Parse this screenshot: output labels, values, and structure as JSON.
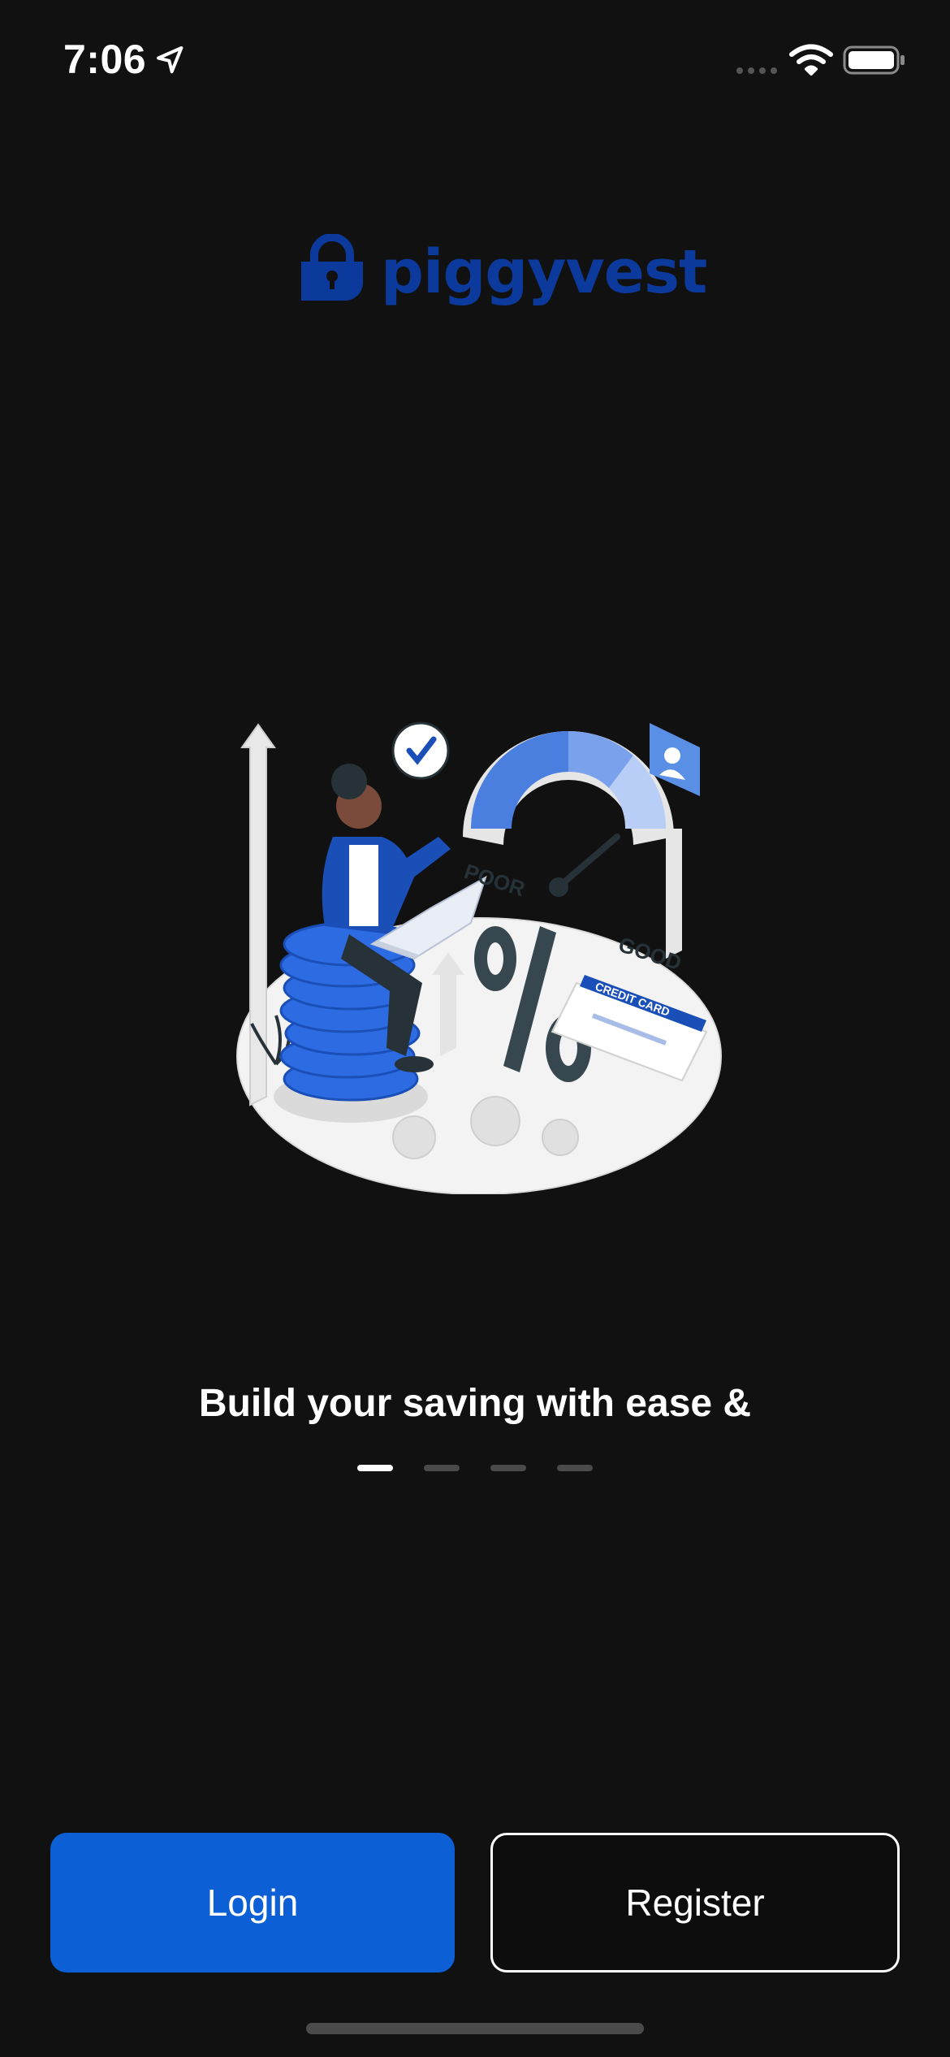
{
  "status_bar": {
    "time": "7:06",
    "icons": [
      "location-arrow-icon",
      "signal-icon",
      "wifi-icon",
      "battery-icon"
    ]
  },
  "brand": {
    "name": "piggyvest",
    "logo_icon": "padlock-icon",
    "color": "#0c3a9c"
  },
  "illustration": {
    "description_icon": "savings-illustration",
    "labels": {
      "poor": "POOR",
      "good": "GOOD",
      "card": "CREDIT CARD"
    }
  },
  "onboarding": {
    "headline": "Build your saving with ease &",
    "pager": {
      "total": 4,
      "active_index": 0
    }
  },
  "actions": {
    "login_label": "Login",
    "register_label": "Register"
  },
  "colors": {
    "background": "#111111",
    "accent": "#0d5fd6"
  }
}
